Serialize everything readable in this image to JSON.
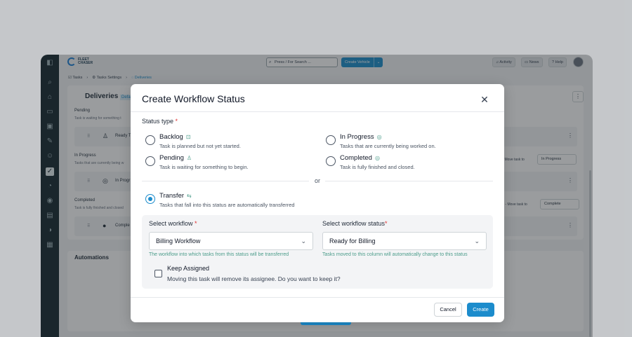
{
  "brand": {
    "line1": "FLEET",
    "line2": "CHASER"
  },
  "search": {
    "placeholder": "Press / For Search ..."
  },
  "header": {
    "create_vehicle": "Create Vehicle",
    "activity": "Activity",
    "news": "News",
    "help": "Help"
  },
  "breadcrumb": [
    "Tasks",
    "Tasks Settings",
    "Deliveries"
  ],
  "background": {
    "title": "Deliveries",
    "badge": "Defa",
    "sections": [
      {
        "label": "Pending",
        "sub": "Task is waiting for something t",
        "row": "Ready T"
      },
      {
        "label": "In Progress",
        "sub": "Tasks that are currently being w",
        "row": "In Progr",
        "move": "sk - Move task to",
        "select": "In Progress"
      },
      {
        "label": "Completed",
        "sub": "Task is fully finished and closed",
        "row": "Comple",
        "move": "sk - Move task to",
        "select": "Complete"
      }
    ],
    "automations": "Automations"
  },
  "modal": {
    "title": "Create Workflow Status",
    "status_type_label": "Status type",
    "required_mark": "*",
    "options": [
      {
        "label": "Backlog",
        "desc": "Task is planned but not yet started.",
        "icon": "inbox-icon"
      },
      {
        "label": "Pending",
        "desc": "Task is waiting for something to begin.",
        "icon": "user-icon"
      },
      {
        "label": "In Progress",
        "desc": "Tasks that are currently being worked on.",
        "icon": "check-circle-icon"
      },
      {
        "label": "Completed",
        "desc": "Task is fully finished and closed.",
        "icon": "check-circle-icon"
      }
    ],
    "or": "or",
    "transfer": {
      "label": "Transfer",
      "desc": "Tasks that fall into this status are automatically transferred",
      "selected": true
    },
    "select_workflow": {
      "label": "Select workflow",
      "value": "Billing Workflow",
      "hint": "The workflow into which tasks from this status will be transferred"
    },
    "select_status": {
      "label": "Select workflow status",
      "value": "Ready for Billing",
      "hint": "Tasks moved to this column will automatically change to this status"
    },
    "keep_assigned": {
      "label": "Keep Assigned",
      "desc": "Moving this task will remove its assignee. Do you want to keep it?",
      "checked": false
    },
    "cancel": "Cancel",
    "create": "Create"
  },
  "colors": {
    "accent": "#1c8ccc",
    "rail": "#16272f",
    "hint": "#4b9c8a",
    "required": "#e03131"
  }
}
